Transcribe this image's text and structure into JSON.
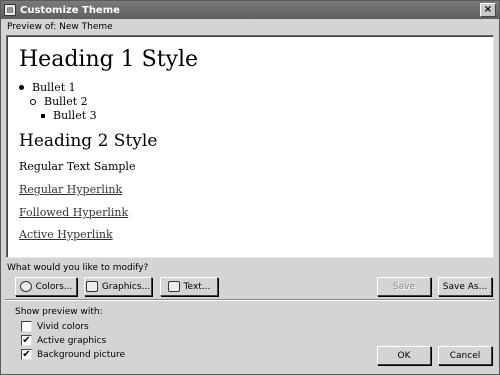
{
  "window": {
    "title": "Customize Theme"
  },
  "preview_label": "Preview of: New Theme",
  "preview": {
    "heading1": "Heading 1 Style",
    "bullets": [
      "Bullet 1",
      "Bullet 2",
      "Bullet 3"
    ],
    "heading2": "Heading 2 Style",
    "regular_text": "Regular Text Sample",
    "regular_link": "Regular Hyperlink",
    "followed_link": "Followed Hyperlink",
    "active_link": "Active Hyperlink"
  },
  "modify_label": "What would you like to modify?",
  "buttons": {
    "colors": "Colors...",
    "graphics": "Graphics...",
    "text": "Text...",
    "save": "Save",
    "save_as": "Save As...",
    "ok": "OK",
    "cancel": "Cancel"
  },
  "show_preview_label": "Show preview with:",
  "options": [
    {
      "label": "Vivid colors",
      "checked": false
    },
    {
      "label": "Active graphics",
      "checked": true
    },
    {
      "label": "Background picture",
      "checked": true
    }
  ],
  "checkmark": "✔"
}
